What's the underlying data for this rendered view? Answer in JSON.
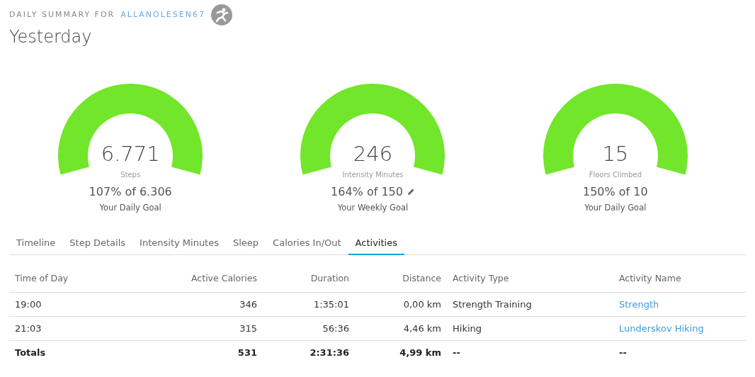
{
  "header": {
    "label": "DAILY SUMMARY FOR",
    "user": "ALLANOLESEN67",
    "title": "Yesterday"
  },
  "gauges": [
    {
      "value": "6.771",
      "unit": "Steps",
      "level": 1,
      "progress": "107% of 6.306",
      "goal": "Your Daily Goal",
      "editable": false
    },
    {
      "value": "246",
      "unit": "Intensity Minutes",
      "level": 1,
      "progress": "164% of 150",
      "goal": "Your Weekly Goal",
      "editable": true
    },
    {
      "value": "15",
      "unit": "Floors Climbed",
      "level": 1,
      "progress": "150% of 10",
      "goal": "Your Daily Goal",
      "editable": false
    }
  ],
  "tabs": [
    {
      "label": "Timeline",
      "selected": false
    },
    {
      "label": "Step Details",
      "selected": false
    },
    {
      "label": "Intensity Minutes",
      "selected": false
    },
    {
      "label": "Sleep",
      "selected": false
    },
    {
      "label": "Calories In/Out",
      "selected": false
    },
    {
      "label": "Activities",
      "selected": true
    }
  ],
  "table": {
    "columns": [
      "Time of Day",
      "Active Calories",
      "Duration",
      "Distance",
      "Activity Type",
      "Activity Name"
    ],
    "rows": [
      [
        "19:00",
        "346",
        "1:35:01",
        "0,00 km",
        "Strength Training",
        "Strength"
      ],
      [
        "21:03",
        "315",
        "56:36",
        "4,46 km",
        "Hiking",
        "Lunderskov Hiking"
      ]
    ],
    "totals": [
      "Totals",
      "531",
      "2:31:36",
      "4,99 km",
      "--",
      "--"
    ]
  }
}
